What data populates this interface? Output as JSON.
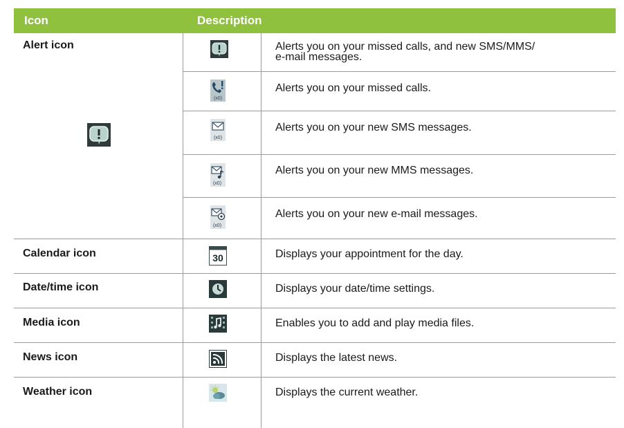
{
  "header": {
    "icon_col": "Icon",
    "desc_col": "Description"
  },
  "rows": [
    {
      "label": "Alert icon",
      "icon": "alert-icon",
      "subrows": [
        {
          "icon": "alert-icon",
          "description_line1": "Alerts you on your missed calls, and new SMS/MMS/",
          "description_line2": "e-mail messages."
        },
        {
          "icon": "missed-call-icon",
          "description": "Alerts you on your missed calls."
        },
        {
          "icon": "sms-icon",
          "description": "Alerts you on your new SMS messages."
        },
        {
          "icon": "mms-icon",
          "description": "Alerts you on your new MMS messages."
        },
        {
          "icon": "email-icon",
          "description": "Alerts you on your new e-mail messages."
        }
      ]
    },
    {
      "label": "Calendar icon",
      "icon": "calendar-icon",
      "icon_text": "30",
      "description": "Displays your appointment for the day."
    },
    {
      "label": "Date/time icon",
      "icon": "clock-icon",
      "description": "Displays your date/time settings."
    },
    {
      "label": "Media icon",
      "icon": "media-icon",
      "description": "Enables you to add and play media files."
    },
    {
      "label": "News icon",
      "icon": "news-icon",
      "description": "Displays the latest news."
    },
    {
      "label": "Weather icon",
      "icon": "weather-icon",
      "description": "Displays the current weather."
    }
  ],
  "icon_badge_text": "(x0)"
}
